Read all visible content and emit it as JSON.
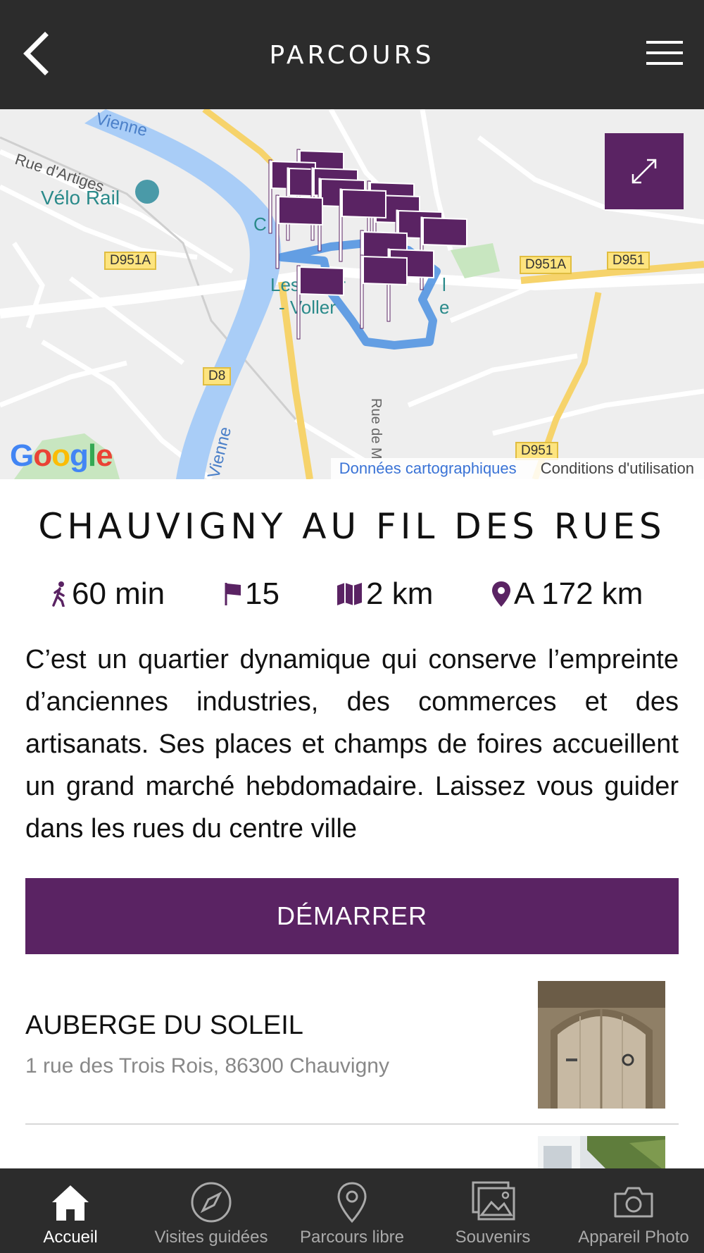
{
  "header": {
    "title": "PARCOURS",
    "back_icon": "chevron-left-icon",
    "menu_icon": "hamburger-icon"
  },
  "map": {
    "labels": {
      "rue_artiges": "Rue d'Artiges",
      "velo_rail": "Vélo Rail",
      "vienne_top": "Vienne",
      "vienne_bottom": "Vienne",
      "d951a_left": "D951A",
      "d951a_right": "D951A",
      "d951_right": "D951",
      "d951_bottom": "D951",
      "d8": "D8",
      "rue_m": "Rue de M",
      "les_gear": "Les Gear",
      "voller": "- Voller",
      "poi_c": "C",
      "poi_l": "l",
      "poi_e": "e"
    },
    "google_logo": "Google",
    "attribution_link": "Données cartographiques",
    "attribution_terms": "Conditions d'utilisation",
    "expand_icon": "expand-arrows-icon",
    "marker_icon": "flag-marker-icon"
  },
  "route": {
    "title": "CHAUVIGNY AU FIL DES RUES",
    "duration": "60 min",
    "steps": "15",
    "distance": "2 km",
    "from_here": "A 172 km",
    "description": "C’est un quartier dynamique qui conserve l’empreinte d’anciennes industries, des commerces et des artisanats. Ses places et champs de foires accueillent un grand marché hebdomadaire. Laissez vous guider dans les rues du centre ville",
    "start_label": "DÉMARRER"
  },
  "poi_list": [
    {
      "name": "AUBERGE DU SOLEIL",
      "address": "1 rue des Trois Rois, 86300 Chauvigny"
    }
  ],
  "tabs": [
    {
      "label": "Accueil",
      "icon": "home-icon",
      "active": true
    },
    {
      "label": "Visites guidées",
      "icon": "compass-icon",
      "active": false
    },
    {
      "label": "Parcours libre",
      "icon": "map-pin-icon",
      "active": false
    },
    {
      "label": "Souvenirs",
      "icon": "photos-icon",
      "active": false
    },
    {
      "label": "Appareil Photo",
      "icon": "camera-icon",
      "active": false
    }
  ],
  "colors": {
    "brand": "#5a2363",
    "bar": "#2c2c2c",
    "route": "#4a8fe0"
  }
}
